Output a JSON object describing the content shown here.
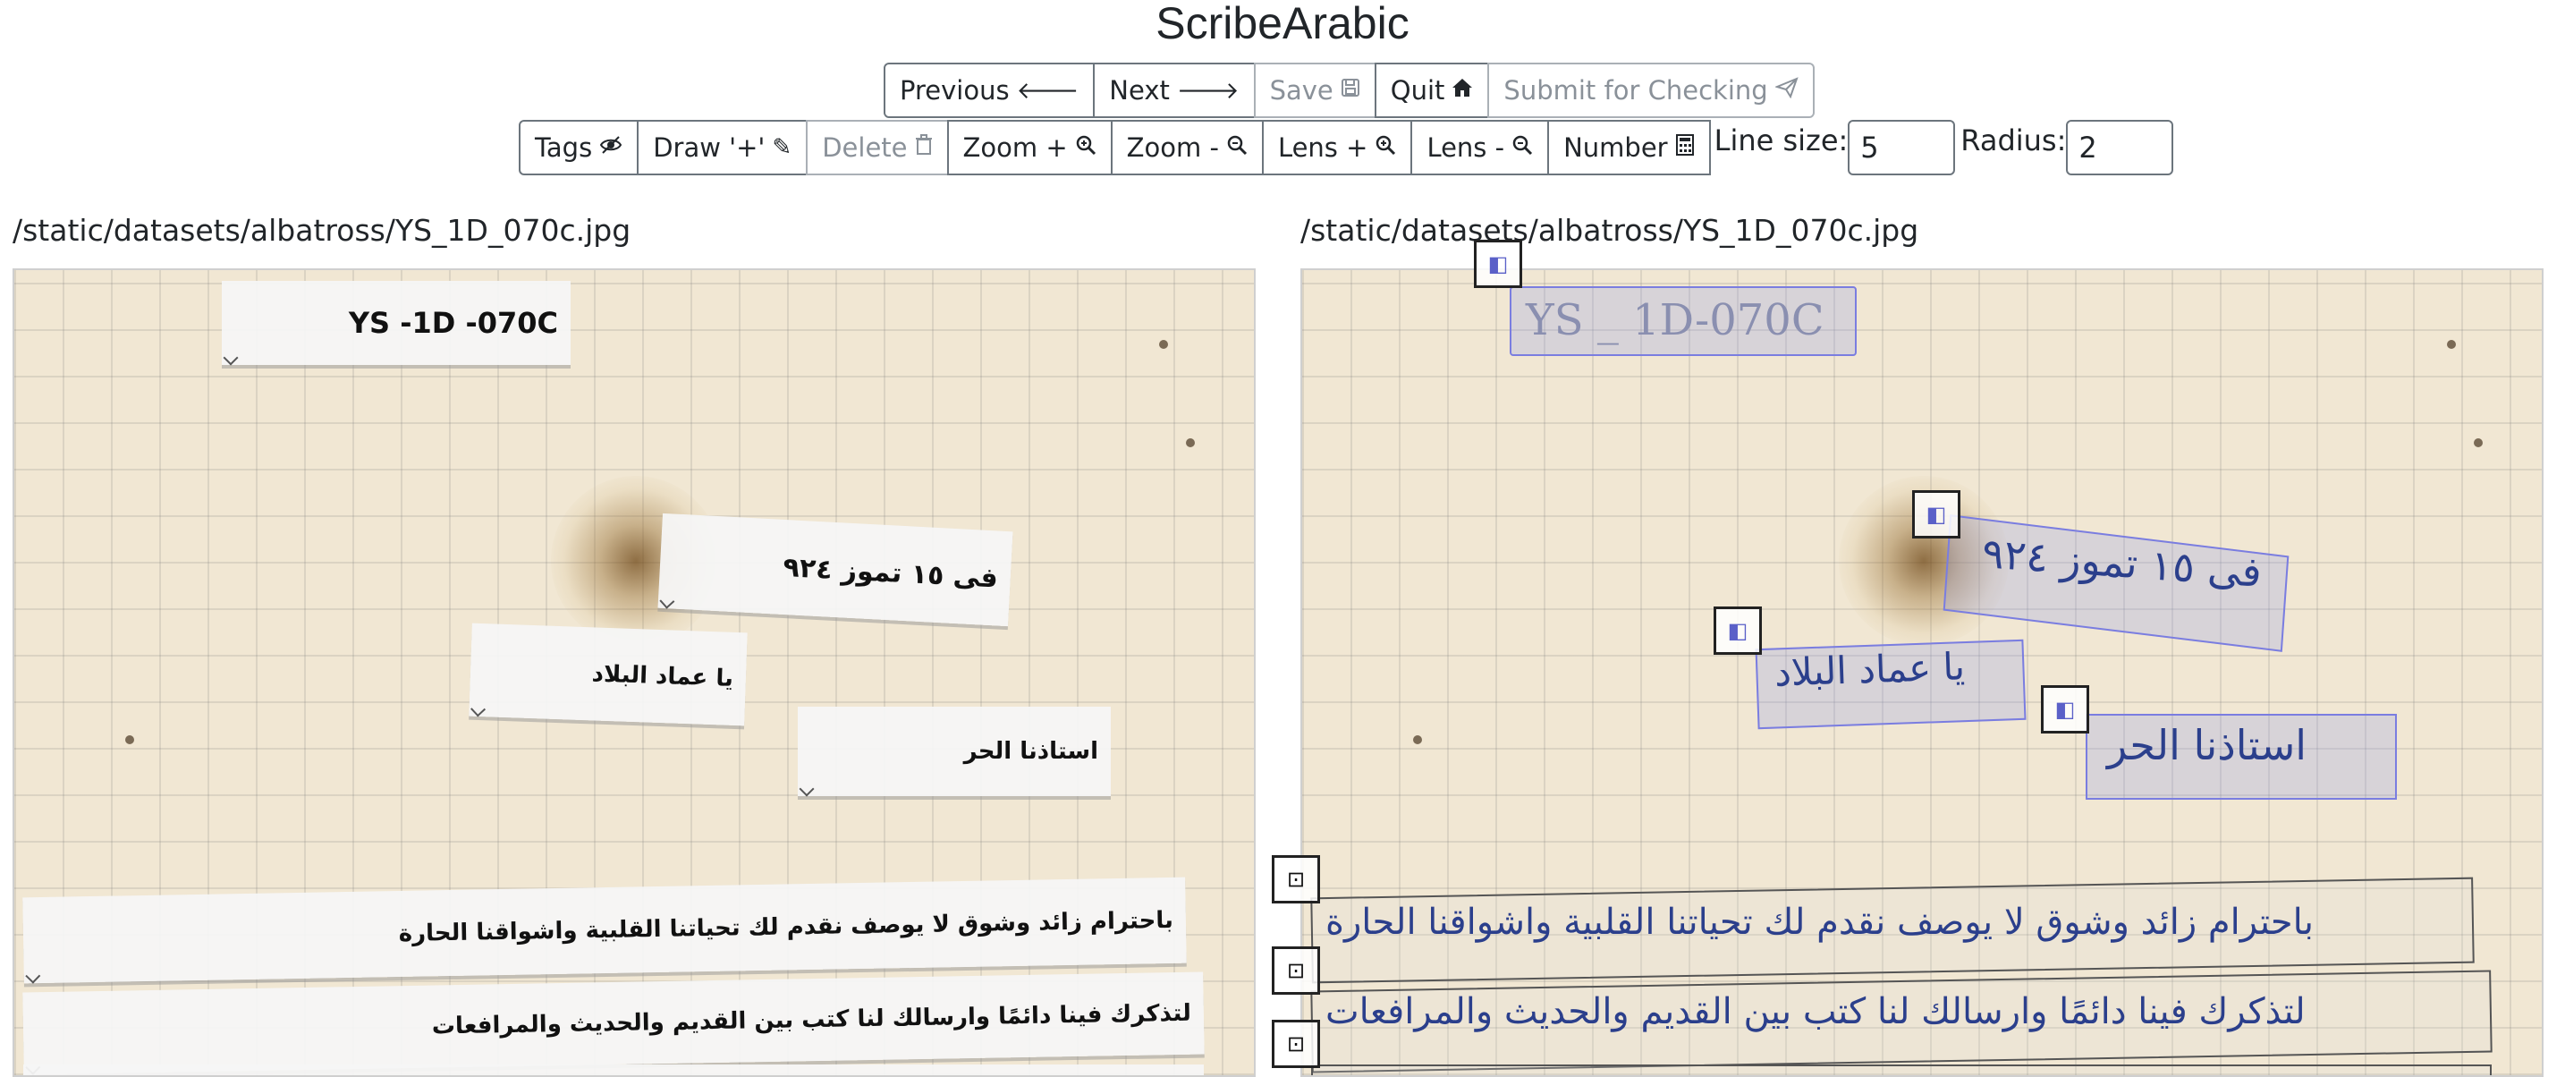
{
  "app": {
    "title": "ScribeArabic"
  },
  "nav": {
    "previous": "Previous",
    "next": "Next",
    "save": "Save",
    "quit": "Quit",
    "submit": "Submit for Checking"
  },
  "toolbar": {
    "tags": "Tags",
    "draw": "Draw '+'",
    "delete": "Delete",
    "zoom_in": "Zoom +",
    "zoom_out": "Zoom -",
    "lens_in": "Lens +",
    "lens_out": "Lens -",
    "number": "Number",
    "line_size_label": "Line size:",
    "line_size_value": "5",
    "radius_label": "Radius:",
    "radius_value": "2"
  },
  "left_panel": {
    "path": "/static/datasets/albatross/YS_1D_070c.jpg",
    "transcriptions": [
      "YS -1D -070C",
      "فى ١٥ تموز ٩٢٤",
      "يا عماد البلاد",
      "استاذنا الحر",
      "باحترام زائد وشوق لا يوصف نقدم لك تحياتنا القلبية واشواقنا الحارة",
      "لتذكرك فينا دائمًا وارسالك لنا كتب بين القديم والحديث والمرافعات"
    ]
  },
  "right_panel": {
    "path": "/static/datasets/albatross/YS_1D_070c.jpg",
    "handwriting": [
      "YS _ 1D-070C",
      "فى ١٥ تموز ٩٢٤",
      "يا عماد البلاد",
      "استاذنا الحر",
      "باحترام زائد وشوق لا يوصف نقدم لك تحياتنا القلبية واشواقنا الحارة",
      "لتذكرك فينا دائمًا وارسالك لنا كتب بين القديم والحديث والمرافعات"
    ]
  },
  "icons": {
    "previous": "arrow-left-icon",
    "next": "arrow-right-icon",
    "save": "floppy-icon",
    "quit": "home-icon",
    "submit": "send-icon",
    "tags": "eye-slash-icon",
    "draw": "pencil-icon",
    "delete": "trash-icon",
    "zoom": "magnifier-icon",
    "number": "calculator-icon"
  }
}
